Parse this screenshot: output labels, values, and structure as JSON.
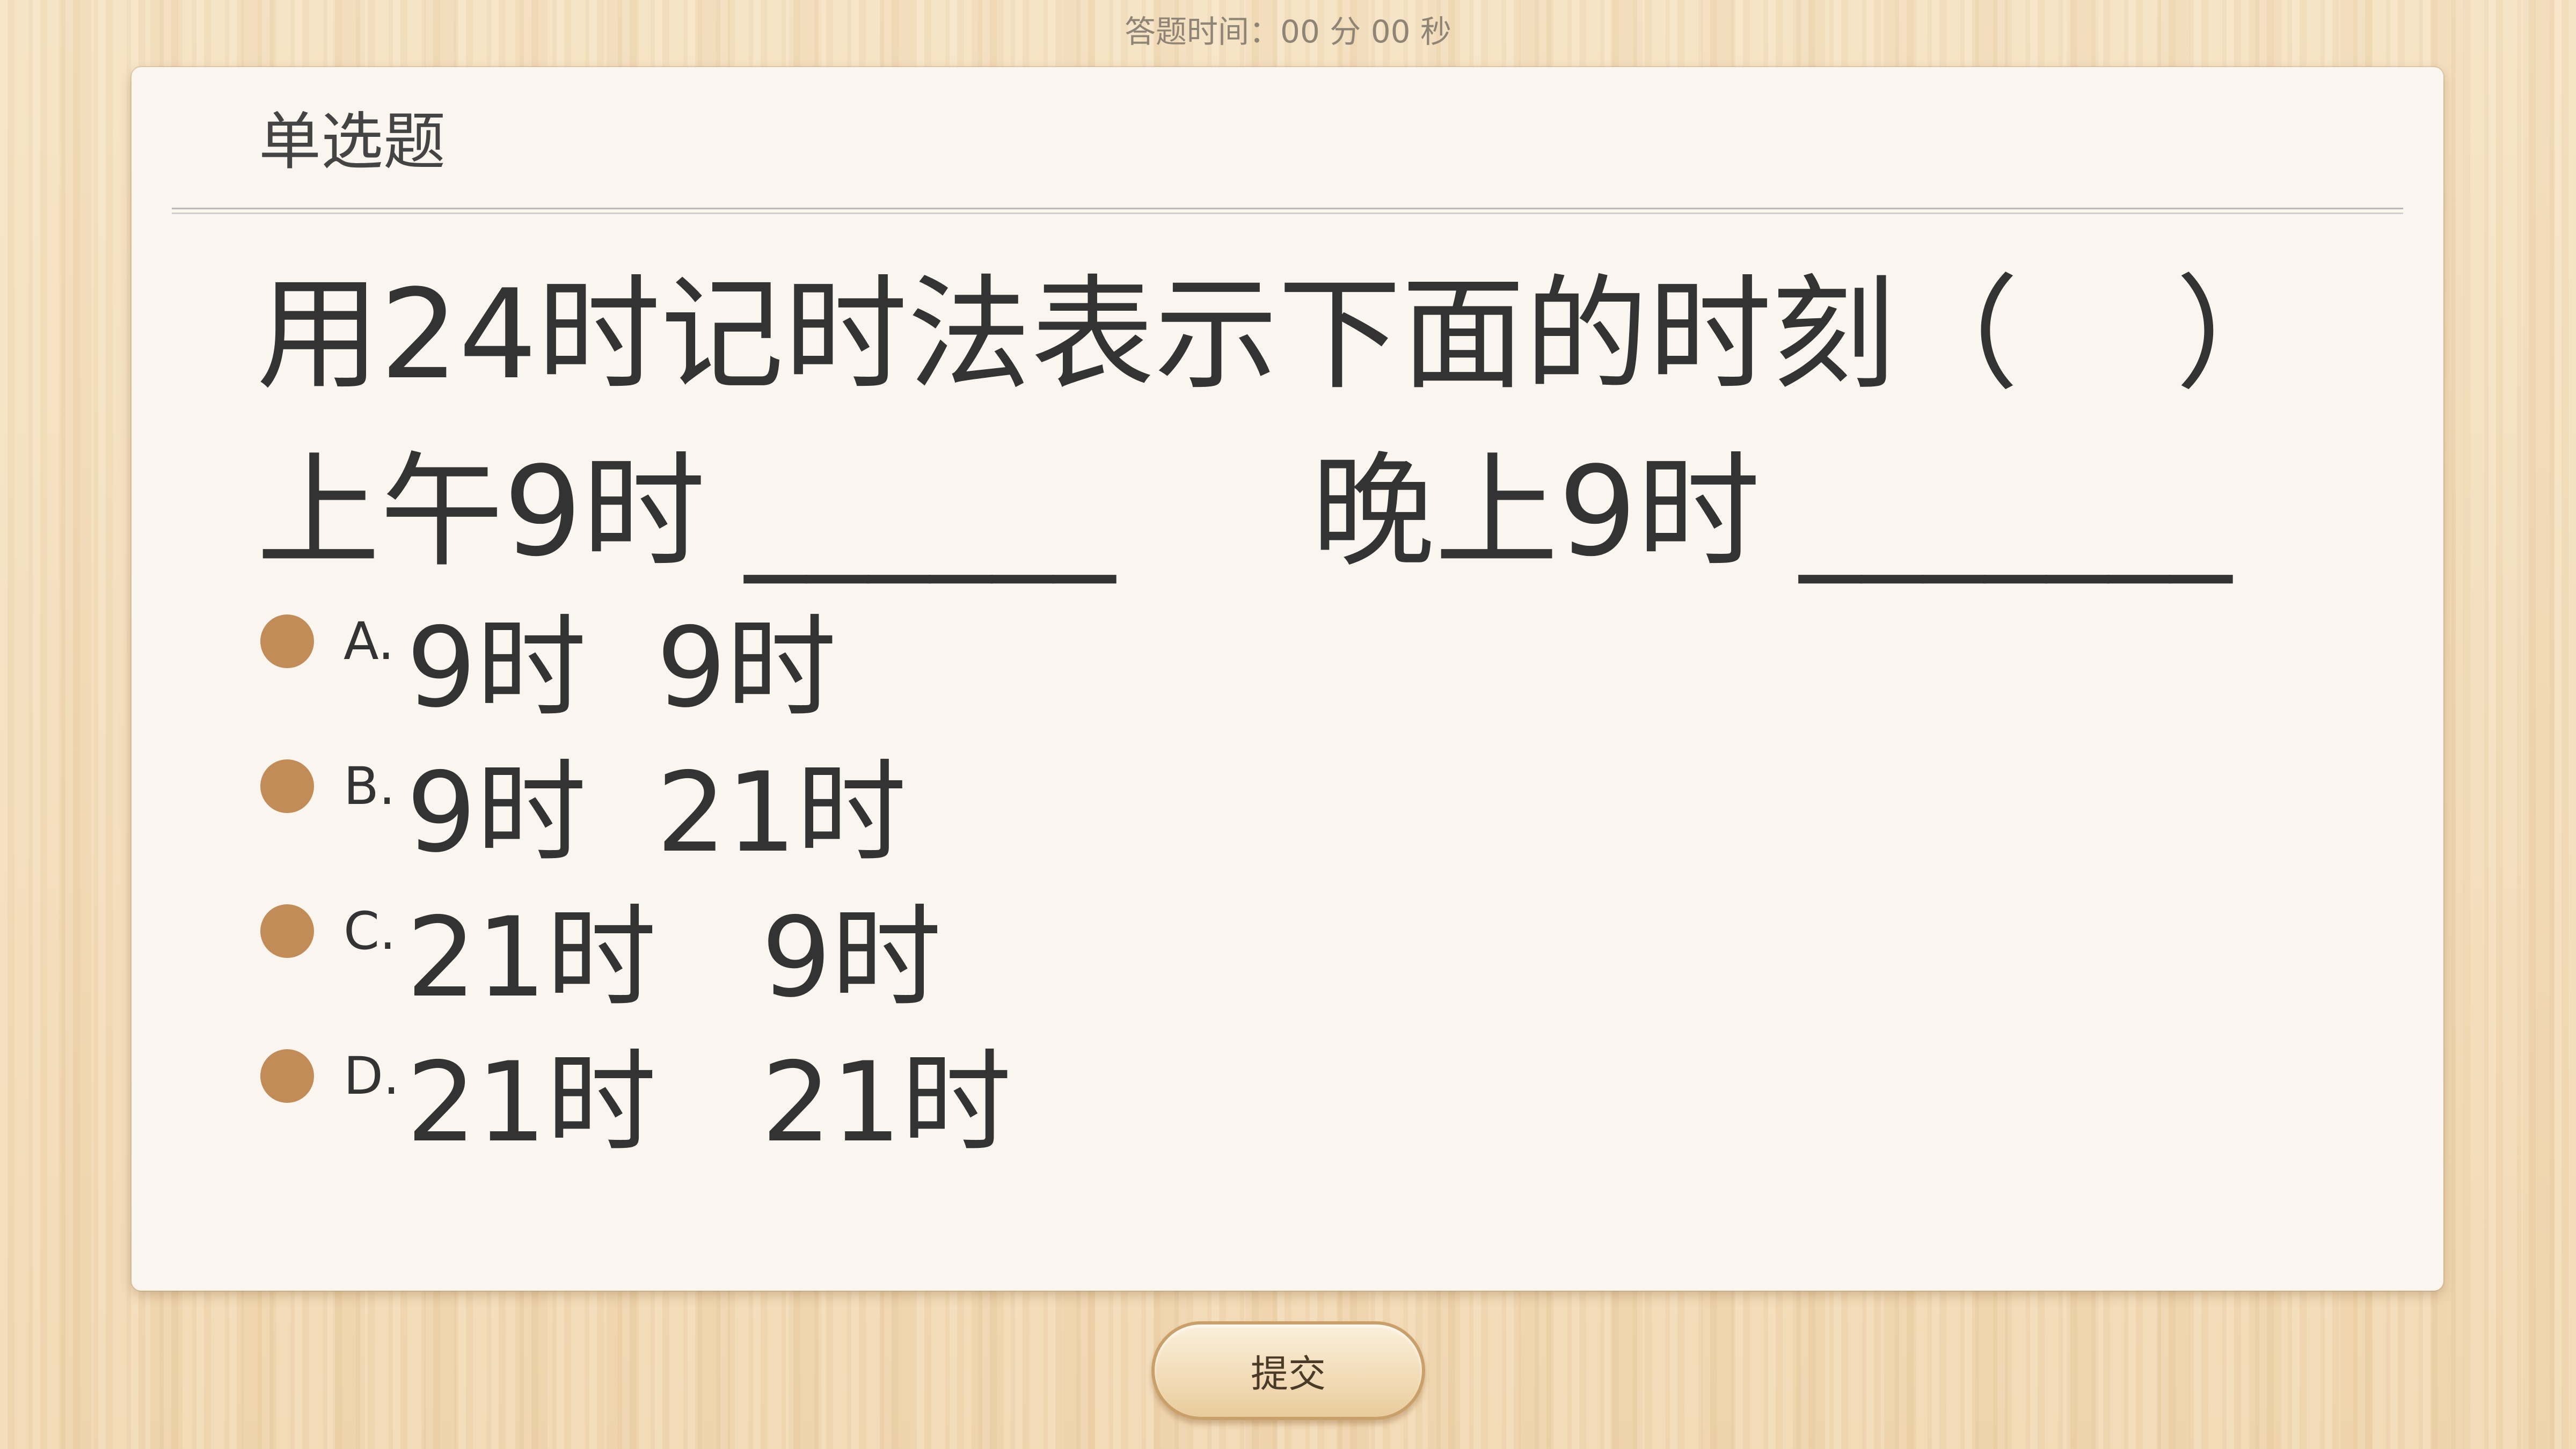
{
  "timer": {
    "label": "答题时间：",
    "value": "00 分 00 秒"
  },
  "question": {
    "type_label": "单选题",
    "line1": "用24时记时法表示下面的时刻（    ）",
    "line2": "上午9时 ______     晚上9时 _______"
  },
  "options": [
    {
      "letter": "A.",
      "text": "9时  9时"
    },
    {
      "letter": "B.",
      "text": "9时  21时"
    },
    {
      "letter": "C.",
      "text": "21时   9时"
    },
    {
      "letter": "D.",
      "text": "21时   21时"
    }
  ],
  "colors": {
    "radio_fill": "#c18c58",
    "card_background": "#faf6ef",
    "page_background": "#f3dcb7"
  },
  "submit": {
    "label": "提交"
  }
}
